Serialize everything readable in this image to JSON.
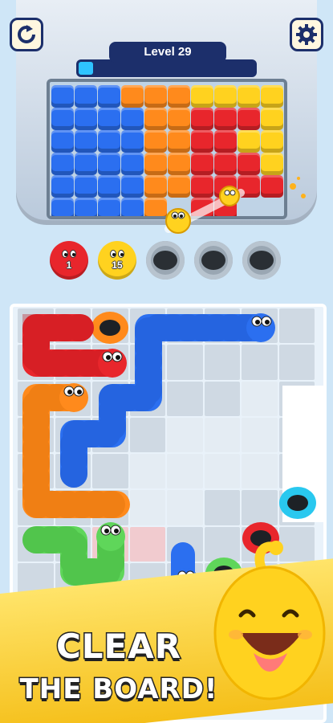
{
  "header": {
    "level_label": "Level 29",
    "progress": 0.08,
    "restart_icon": "restart-icon",
    "settings_icon": "gear-icon"
  },
  "queue": {
    "slots": [
      {
        "color": "#e8262c",
        "count": "1",
        "state": "filled"
      },
      {
        "color": "#ffd21f",
        "count": "15",
        "state": "filled"
      },
      {
        "state": "empty"
      },
      {
        "state": "empty"
      },
      {
        "state": "empty"
      }
    ]
  },
  "banner": {
    "line1": "CLEAR",
    "line2": "THE BOARD!"
  },
  "colors": {
    "blue": "#2b6ff0",
    "orange": "#ff8a1c",
    "red": "#e8262c",
    "yellow": "#ffd21f",
    "green": "#5fd65a",
    "cyan": "#29c8ef"
  }
}
